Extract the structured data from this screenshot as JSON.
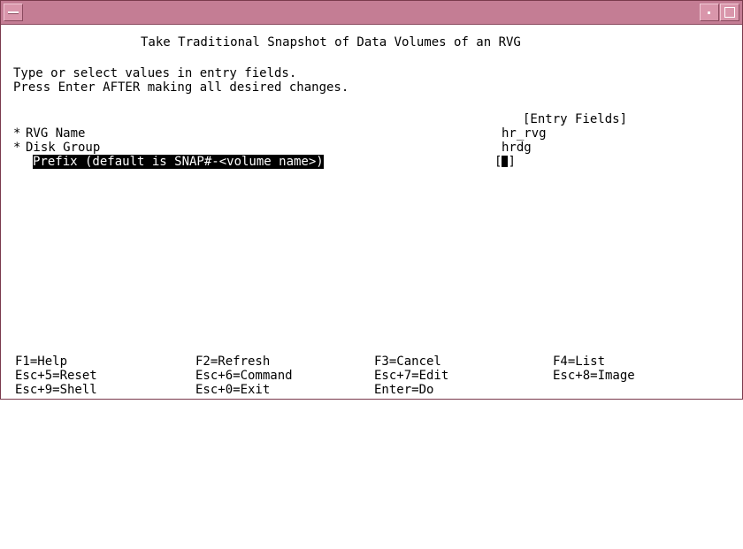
{
  "window": {
    "title": ""
  },
  "screen": {
    "title": "Take Traditional Snapshot of Data Volumes of an RVG",
    "instructions": [
      "Type or select values in entry fields.",
      "Press Enter AFTER making all desired changes."
    ],
    "entry_fields_header": "[Entry Fields]",
    "fields": [
      {
        "marker": "*",
        "label": "RVG Name",
        "value": "hr_rvg"
      },
      {
        "marker": "*",
        "label": "Disk Group",
        "value": "hrdg"
      },
      {
        "marker": " ",
        "label": "Prefix (default is SNAP#-<volume name>)",
        "open_bracket": "[",
        "value": "",
        "close_bracket": "]"
      }
    ]
  },
  "function_keys": [
    [
      "F1=Help",
      "F2=Refresh",
      "F3=Cancel",
      "F4=List"
    ],
    [
      "Esc+5=Reset",
      "Esc+6=Command",
      "Esc+7=Edit",
      "Esc+8=Image"
    ],
    [
      "Esc+9=Shell",
      "Esc+0=Exit",
      "Enter=Do",
      ""
    ]
  ],
  "colors": {
    "titlebar": "#c47d94",
    "highlight_bg": "#000000",
    "highlight_fg": "#ffffff"
  }
}
